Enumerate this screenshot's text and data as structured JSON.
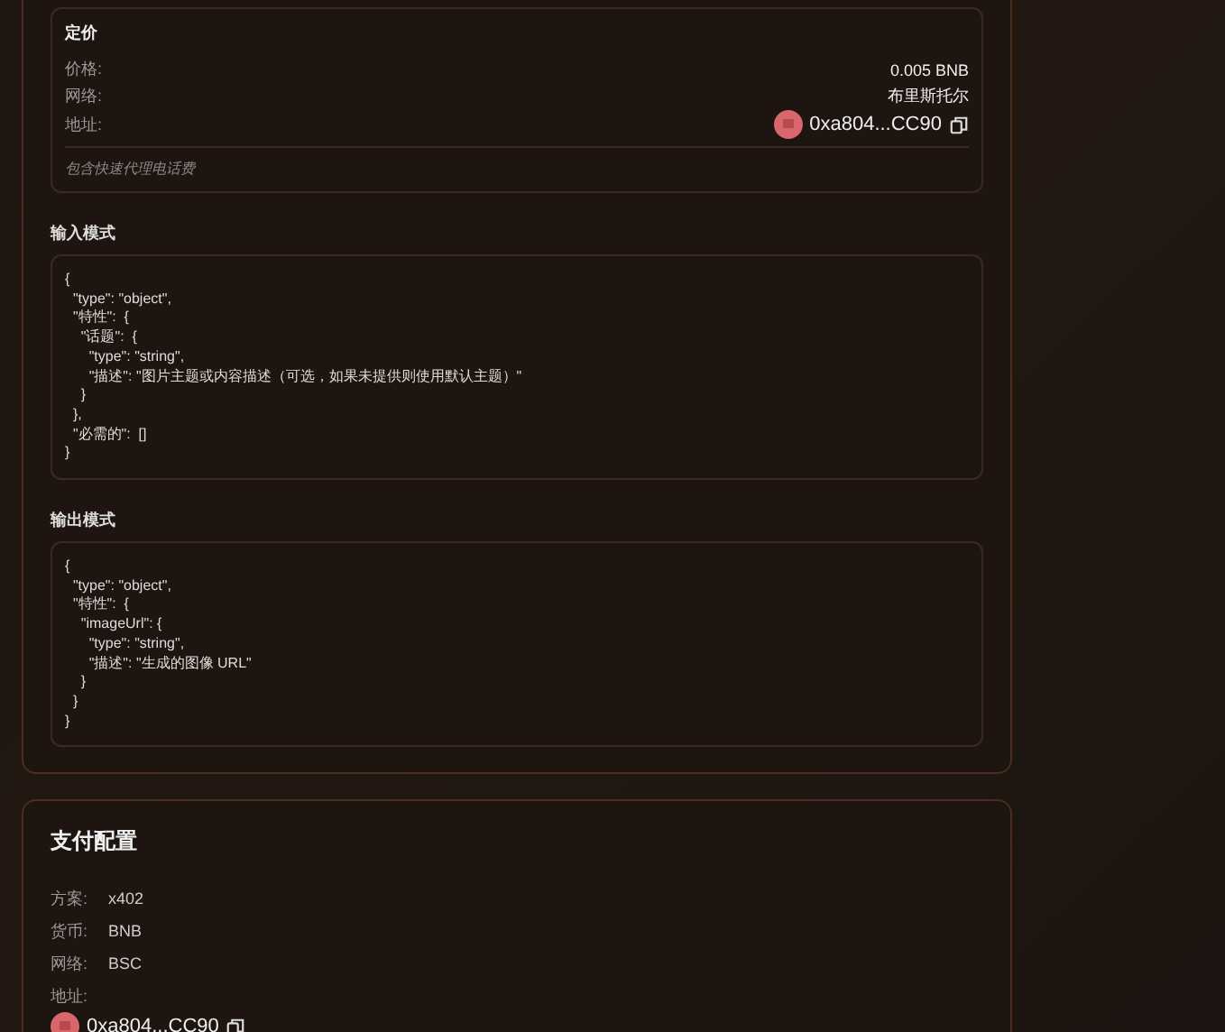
{
  "pricing": {
    "title": "定价",
    "rows": [
      {
        "label": "价格:",
        "value": "0.005 BNB",
        "kind": "text"
      },
      {
        "label": "网络:",
        "value": "布里斯托尔",
        "kind": "text"
      },
      {
        "label": "地址:",
        "value": "0xa804...CC90",
        "kind": "address"
      }
    ],
    "note": "包含快速代理电话费"
  },
  "input_schema": {
    "title": "输入模式",
    "lines": [
      "{",
      "  \"type\": \"object\",",
      "  \"特性\":  {",
      "    \"话题\":  {",
      "      \"type\": \"string\",",
      "      \"描述\": \"图片主题或内容描述（可选，如果未提供则使用默认主题）\"",
      "    }",
      "  },",
      "  \"必需的\":  []",
      "}"
    ]
  },
  "output_schema": {
    "title": "输出模式",
    "lines": [
      "{",
      "  \"type\": \"object\",",
      "  \"特性\":  {",
      "    \"imageUrl\": {",
      "      \"type\": \"string\",",
      "      \"描述\": \"生成的图像 URL\"",
      "    }",
      "  }",
      "}"
    ]
  },
  "payment": {
    "title": "支付配置",
    "rows": [
      {
        "label": "方案:",
        "value": "x402"
      },
      {
        "label": "货币:",
        "value": "BNB"
      },
      {
        "label": "网络:",
        "value": "BSC"
      }
    ],
    "address_label": "地址:",
    "address": "0xa804...CC90"
  }
}
